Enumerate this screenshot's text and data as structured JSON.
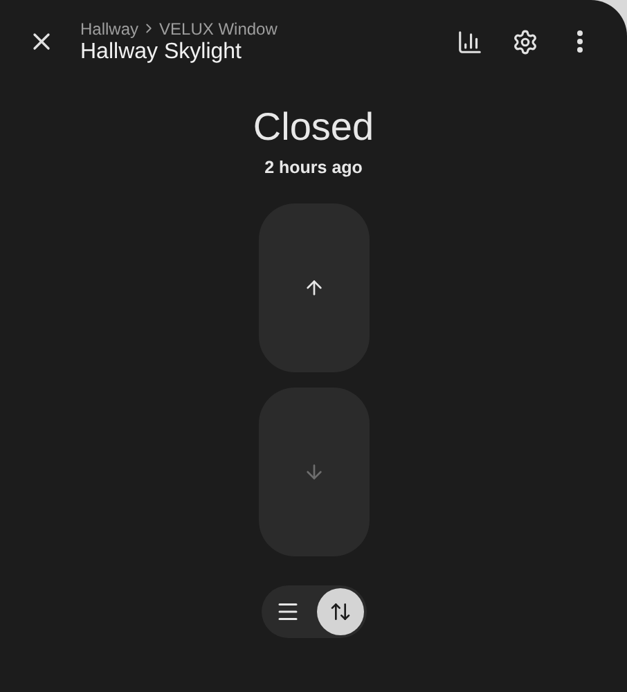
{
  "header": {
    "breadcrumb": [
      "Hallway",
      "VELUX Window"
    ],
    "title": "Hallway Skylight"
  },
  "state": {
    "value": "Closed",
    "time": "2 hours ago"
  },
  "controls": [
    {
      "kind": "up",
      "disabled": false
    },
    {
      "kind": "down",
      "disabled": true
    }
  ],
  "modes": [
    {
      "kind": "list",
      "selected": false
    },
    {
      "kind": "updown",
      "selected": true
    }
  ]
}
